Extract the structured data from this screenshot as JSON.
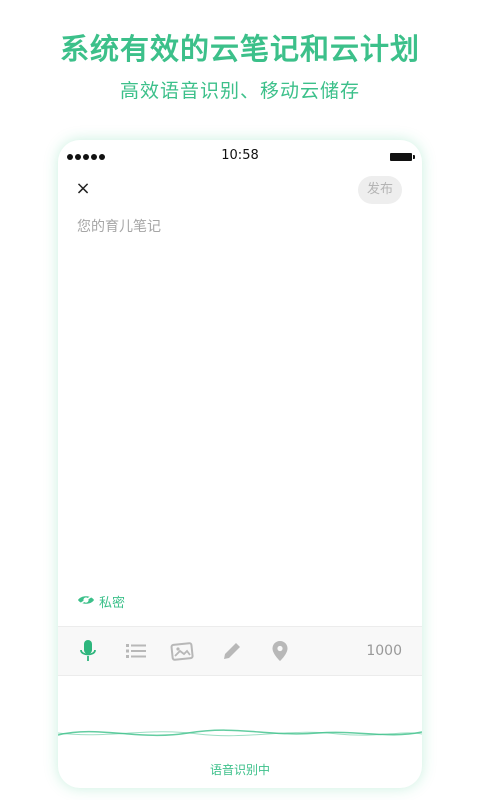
{
  "banner": {
    "title": "系统有效的云笔记和云计划",
    "subtitle": "高效语音识别、移动云储存"
  },
  "status_bar": {
    "time": "10:58"
  },
  "editor": {
    "close_label": "×",
    "publish_label": "发布",
    "placeholder": "您的育儿笔记",
    "private_label": "私密"
  },
  "toolbar": {
    "tools": [
      "microphone-icon",
      "list-icon",
      "image-icon",
      "pencil-icon",
      "location-pin-icon"
    ],
    "char_count": "1000"
  },
  "voice": {
    "status": "语音识别中"
  },
  "colors": {
    "accent": "#3cc08a",
    "active_icon": "#2eb67d",
    "inactive_icon": "#b8b8b8",
    "publish_bg": "#eeeeee",
    "publish_text": "#b4b4b4"
  }
}
